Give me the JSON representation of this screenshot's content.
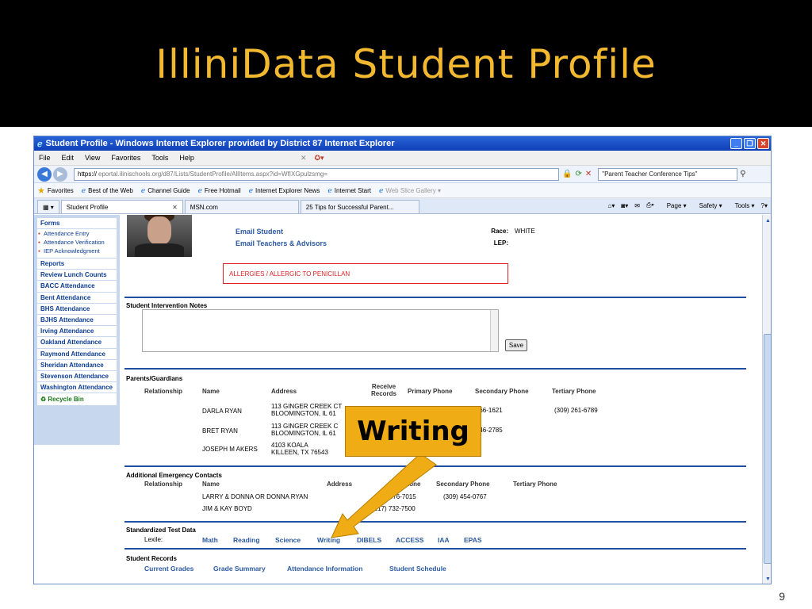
{
  "slide": {
    "title": "IlliniData Student Profile",
    "page_number": "9",
    "callout_text": "Writing"
  },
  "browser": {
    "window_title": "Student Profile - Windows Internet Explorer provided by District 87 Internet Explorer",
    "menu": [
      "File",
      "Edit",
      "View",
      "Favorites",
      "Tools",
      "Help"
    ],
    "url_scheme": "https://",
    "url_rest": "eportal.ilinischools.org/d87/Lists/StudentProfile/AllItems.aspx?id=WfIXGpulzsmg=",
    "search_text": "\"Parent Teacher Conference Tips\"",
    "favorites_label": "Favorites",
    "favorites": [
      "Best of the Web",
      "Channel Guide",
      "Free Hotmail",
      "Internet Explorer News",
      "Internet Start",
      "Web Slice Gallery"
    ],
    "tabs": [
      "Student Profile",
      "MSN.com",
      "25 Tips for Successful Parent..."
    ],
    "tab_tools": [
      "Page",
      "Safety",
      "Tools"
    ]
  },
  "sidebar": {
    "forms_title": "Forms",
    "form_items": [
      "Attendance Entry",
      "Attendance Verification",
      "IEP Acknowledgment"
    ],
    "reports_title": "Reports",
    "report_links": [
      "Review Lunch Counts",
      "BACC Attendance",
      "Bent Attendance",
      "BHS Attendance",
      "BJHS Attendance",
      "Irving Attendance",
      "Oakland Attendance",
      "Raymond Attendance",
      "Sheridan Attendance",
      "Stevenson Attendance",
      "Washington Attendance"
    ],
    "recycle_bin": "Recycle Bin"
  },
  "profile": {
    "email_student": "Email Student",
    "email_teachers": "Email Teachers & Advisors",
    "race_label": "Race:",
    "race_value": "WHITE",
    "lep_label": "LEP:",
    "allergy": "ALLERGIES / ALLERGIC TO PENICILLAN"
  },
  "intervention": {
    "title": "Student Intervention Notes",
    "save": "Save"
  },
  "parents": {
    "title": "Parents/Guardians",
    "headers": [
      "Relationship",
      "Name",
      "Address",
      "Receive Records",
      "Primary Phone",
      "Secondary Phone",
      "Tertiary Phone"
    ],
    "rows": [
      {
        "name": "DARLA RYAN",
        "address1": "113 GINGER CREEK CT",
        "address2": "BLOOMINGTON, IL 61",
        "primary": "(309) 766-1621",
        "tertiary": "(309) 261-6789"
      },
      {
        "name": "BRET RYAN",
        "address1": "113 GINGER CREEK C",
        "address2": "BLOOMINGTON, IL 61",
        "primary": "(309) 846-2785",
        "tertiary": ""
      },
      {
        "name": "JOSEPH M AKERS",
        "address1": "4103 KOALA",
        "address2": "KILLEEN, TX 76543",
        "primary": "",
        "tertiary": ""
      }
    ]
  },
  "emergency": {
    "title": "Additional Emergency Contacts",
    "headers": [
      "Relationship",
      "Name",
      "Address",
      "Phone",
      "Secondary Phone",
      "Tertiary Phone"
    ],
    "rows": [
      {
        "name": "LARRY & DONNA OR DONNA RYAN",
        "phone": ") 376-7015",
        "secondary": "(309) 454-0767"
      },
      {
        "name": "JIM & KAY BOYD",
        "phone": "(217) 732-7500",
        "secondary": ""
      }
    ]
  },
  "tests": {
    "title": "Standardized Test Data",
    "lexile_label": "Lexile:",
    "links": [
      "Math",
      "Reading",
      "Science",
      "Writing",
      "DIBELS",
      "ACCESS",
      "IAA",
      "EPAS"
    ]
  },
  "records": {
    "title": "Student Records",
    "links": [
      "Current Grades",
      "Grade Summary",
      "Attendance Information",
      "Student Schedule"
    ]
  },
  "colors": {
    "accent_gold": "#f0ac14",
    "title_gold": "#f2b830",
    "link_blue": "#2c5aa0",
    "rule_blue": "#1f4fa0",
    "allergy_red": "#dd2222"
  }
}
